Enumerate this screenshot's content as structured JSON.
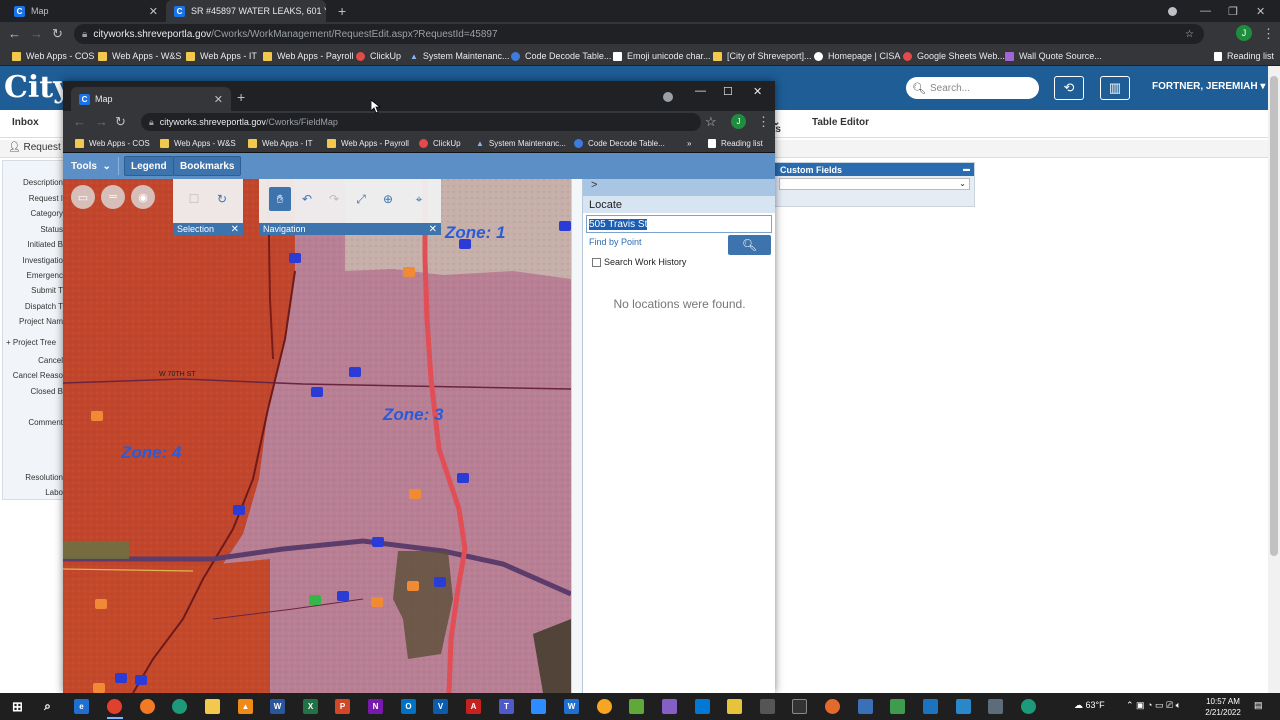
{
  "outer_browser": {
    "tabs": [
      {
        "title": "Map",
        "favicon": "C"
      },
      {
        "title": "SR #45897 WATER LEAKS, 601 Ya",
        "favicon": "C"
      }
    ],
    "new_tab_symbol": "+",
    "url_host": "cityworks.shreveportla.gov",
    "url_path": "/Cworks/WorkManagement/RequestEdit.aspx?RequestId=45897",
    "profile_initial": "J",
    "bookmarks": [
      "Web Apps - COS",
      "Web Apps - W&S",
      "Web Apps - IT",
      "Web Apps - Payroll",
      "ClickUp",
      "System Maintenanc...",
      "Code Decode Table...",
      "Emoji unicode char...",
      "[City of Shreveport]...",
      "Homepage | CISA",
      "Google Sheets Web...",
      "Wall Quote Source..."
    ],
    "reading_list": "Reading list"
  },
  "cityworks": {
    "logo": "Cityw",
    "search_placeholder": "Search...",
    "user": "FORTNER, JEREMIAH",
    "menu": [
      "Inbox",
      "ts",
      "Table Editor"
    ],
    "request_tab": "Request",
    "field_labels": [
      "Description",
      "Request I",
      "Category",
      "Status",
      "Initiated B",
      "Investigatio",
      "Emergenc",
      "Submit T",
      "Dispatch T",
      "Project Nam",
      "Project Tree",
      "Cancel",
      "Cancel Reaso",
      "Closed B",
      "Comment",
      "Resolution",
      "Labo"
    ],
    "custom_fields_title": "Custom Fields"
  },
  "popup": {
    "tab_title": "Map",
    "url_host": "cityworks.shreveportla.gov",
    "url_path": "/Cworks/FieldMap",
    "profile_initial": "J",
    "bookmarks": [
      "Web Apps - COS",
      "Web Apps - W&S",
      "Web Apps - IT",
      "Web Apps - Payroll",
      "ClickUp",
      "System Maintenanc...",
      "Code Decode Table..."
    ],
    "more_bookmarks": "»",
    "reading_list": "Reading list",
    "toolbar": {
      "tools": "Tools",
      "legend": "Legend",
      "bookmarks": "Bookmarks"
    },
    "map": {
      "zones": [
        "Zone: 1",
        "Zone: 3",
        "Zone: 4"
      ],
      "street_label": "W 70TH ST",
      "selection_widget": "Selection",
      "navigation_widget": "Navigation",
      "colors": {
        "zone4": "#c2462c",
        "zone3": "#b97f94",
        "zone1": "#c6b0a9",
        "highway": "#e24e55",
        "icon_blue": "#2a3bd6",
        "icon_orange": "#f08a35",
        "icon_green": "#34b648"
      }
    },
    "locate": {
      "title": "Locate",
      "expand_symbol": ">",
      "input_value": "505 Travis St",
      "find_by_point": "Find by Point",
      "search_history_label": "Search Work History",
      "search_history_checked": false,
      "no_results": "No locations were found."
    }
  },
  "taskbar": {
    "weather": "63°F",
    "time": "10:57 AM",
    "date": "2/21/2022"
  }
}
